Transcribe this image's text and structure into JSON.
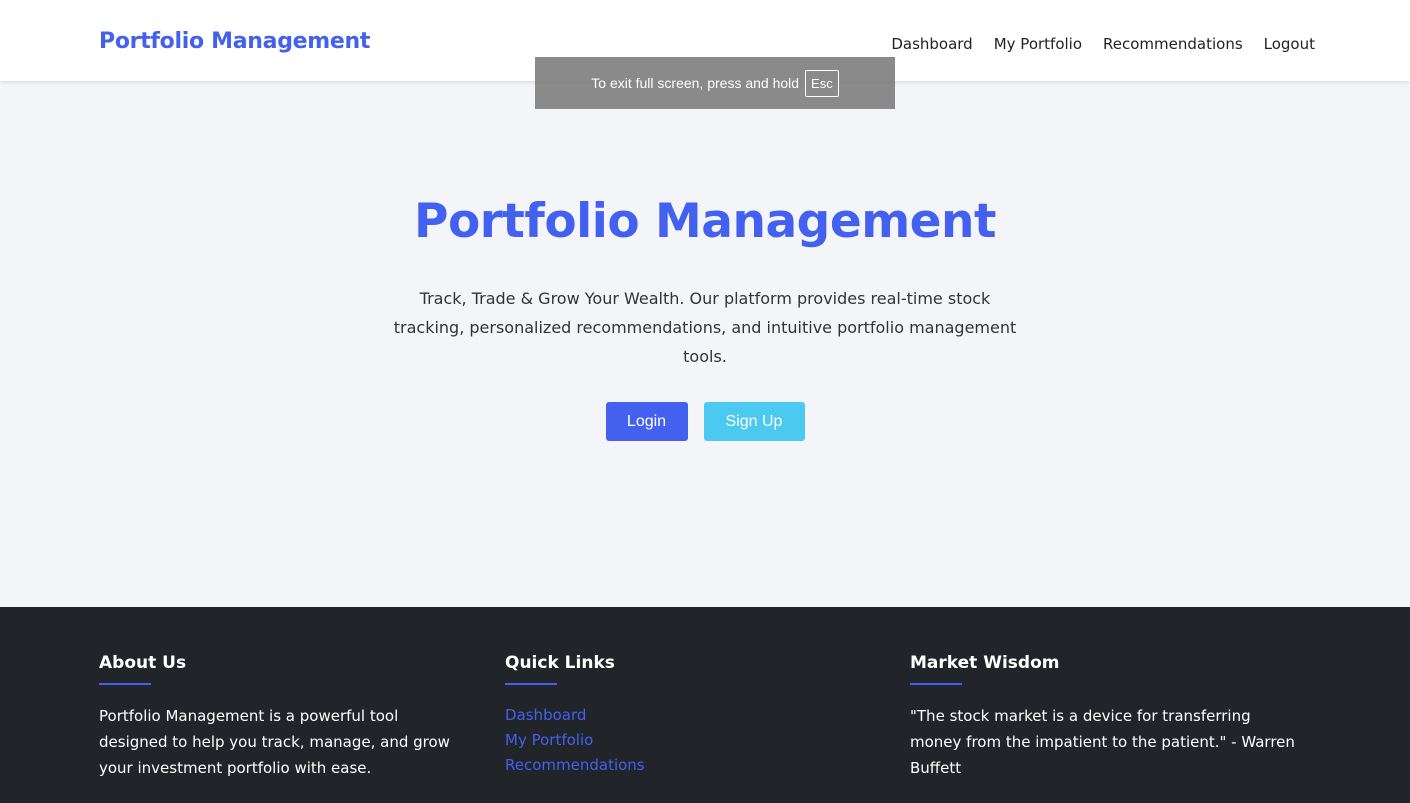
{
  "header": {
    "brand": "Portfolio Management",
    "nav": [
      "Dashboard",
      "My Portfolio",
      "Recommendations",
      "Logout"
    ]
  },
  "fullscreen_notice": {
    "text": "To exit full screen, press and hold",
    "key": "Esc"
  },
  "hero": {
    "title": "Portfolio Management",
    "description": "Track, Trade & Grow Your Wealth. Our platform provides real-time stock tracking, personalized recommendations, and intuitive portfolio management tools.",
    "login_label": "Login",
    "signup_label": "Sign Up"
  },
  "footer": {
    "about": {
      "heading": "About Us",
      "text": "Portfolio Management is a powerful tool designed to help you track, manage, and grow your investment portfolio with ease."
    },
    "links": {
      "heading": "Quick Links",
      "items": [
        "Dashboard",
        "My Portfolio",
        "Recommendations"
      ]
    },
    "wisdom": {
      "heading": "Market Wisdom",
      "quote": "\"The stock market is a device for transferring money from the impatient to the patient.\" - Warren Buffett"
    }
  },
  "colors": {
    "primary": "#4361ee",
    "secondary": "#4cc9f0",
    "footer_bg": "#212529",
    "page_bg": "#f4f5f9"
  }
}
